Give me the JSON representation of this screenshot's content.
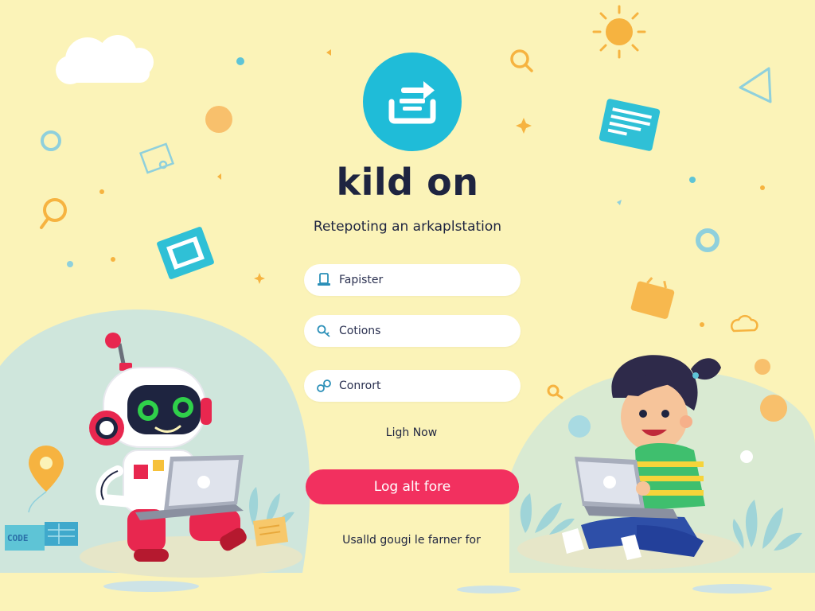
{
  "app": {
    "title": "kild on",
    "subtitle": "Retepoting an arkaplstation"
  },
  "form": {
    "fields": [
      {
        "label": "Fapister",
        "icon": "device-icon"
      },
      {
        "label": "Cotions",
        "icon": "key-icon"
      },
      {
        "label": "Conrort",
        "icon": "link-icon"
      }
    ],
    "secondary_link": "Ligh Now",
    "primary_button": "Log alt fore",
    "footer": "Usalld gougi le farner for"
  },
  "illustration": {
    "code_tag": "CODE"
  },
  "colors": {
    "background": "#fbf3b8",
    "accent_cyan": "#1fbcd8",
    "primary_button": "#f2305f",
    "title_text": "#1e2440"
  }
}
